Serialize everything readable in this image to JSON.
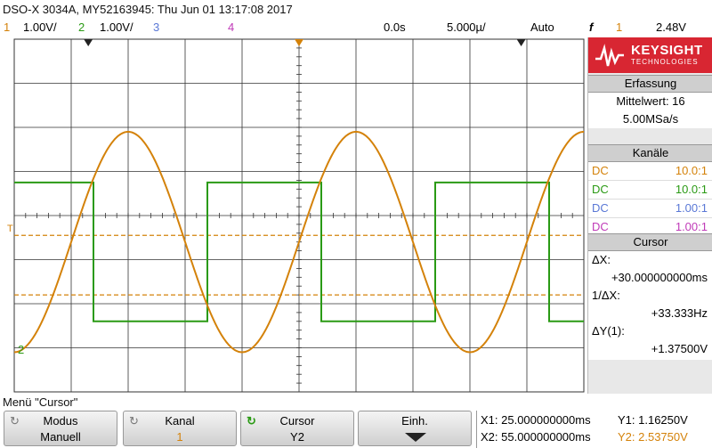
{
  "header": {
    "title": "DSO-X 3034A, MY52163945: Thu Jun 01 13:17:08 2017"
  },
  "status": {
    "ch1_num": "1",
    "ch1_scale": "1.00V/",
    "ch2_num": "2",
    "ch2_scale": "1.00V/",
    "ch3_num": "3",
    "ch4_num": "4",
    "time_delay": "0.0s",
    "time_scale": "5.000µ/",
    "trigger_mode": "Auto",
    "trigger_icon": "f",
    "trigger_channel": "1",
    "trigger_level": "2.48V"
  },
  "colors": {
    "ch1": "#d4820a",
    "ch2": "#2a9a14",
    "ch3": "#5a78d6",
    "ch4": "#c03ab8",
    "grid": "#333333",
    "brand": "#d82632"
  },
  "scope": {
    "ch1_marker": "T",
    "ch2_marker": "2"
  },
  "chart_data": {
    "type": "line",
    "x": [
      -25,
      -20,
      -15,
      -10,
      -5,
      0,
      5,
      10,
      15,
      20,
      25
    ],
    "series": [
      {
        "name": "1",
        "shape": "sine",
        "period_us": 20,
        "amplitude_div": 2.5,
        "offset_div": -0.6,
        "phase_zero_us": 0
      },
      {
        "name": "2",
        "shape": "square",
        "period_us": 20,
        "high_div": 0.75,
        "low_div": -2.4,
        "rise_us": -8.1
      }
    ],
    "xlim": [
      -25,
      25
    ],
    "ylim": [
      -4,
      4
    ],
    "grid": true,
    "cursors": {
      "x1_div": 25.0,
      "x2_div": 55.0,
      "y1_volts": 1.1625,
      "y2_volts": 2.5375
    }
  },
  "panel": {
    "logo_word": "KEYSIGHT",
    "logo_sub": "TECHNOLOGIES",
    "acq_title": "Erfassung",
    "acq_mode": "Mittelwert: 16",
    "acq_rate": "5.00MSa/s",
    "ch_title": "Kanäle",
    "channels": [
      {
        "coupling": "DC",
        "probe": "10.0:1"
      },
      {
        "coupling": "DC",
        "probe": "10.0:1"
      },
      {
        "coupling": "DC",
        "probe": "1.00:1"
      },
      {
        "coupling": "DC",
        "probe": "1.00:1"
      }
    ],
    "cursor_title": "Cursor",
    "dx_label": "ΔX:",
    "dx_value": "+30.000000000ms",
    "inv_dx_label": "1/ΔX:",
    "inv_dx_value": "+33.333Hz",
    "dy_label": "ΔY(1):",
    "dy_value": "+1.37500V"
  },
  "menu": {
    "title": "Menü \"Cursor\"",
    "softkeys": [
      {
        "top": "Modus",
        "bottom": "Manuell"
      },
      {
        "top": "Kanal",
        "bottom": "1"
      },
      {
        "top": "Cursor",
        "bottom": "Y2"
      },
      {
        "top": "Einh.",
        "bottom": ""
      }
    ]
  },
  "readout": {
    "x1": "X1: 25.000000000ms",
    "x2": "X2: 55.000000000ms",
    "y1": "Y1: 1.16250V",
    "y2": "Y2: 2.53750V"
  }
}
